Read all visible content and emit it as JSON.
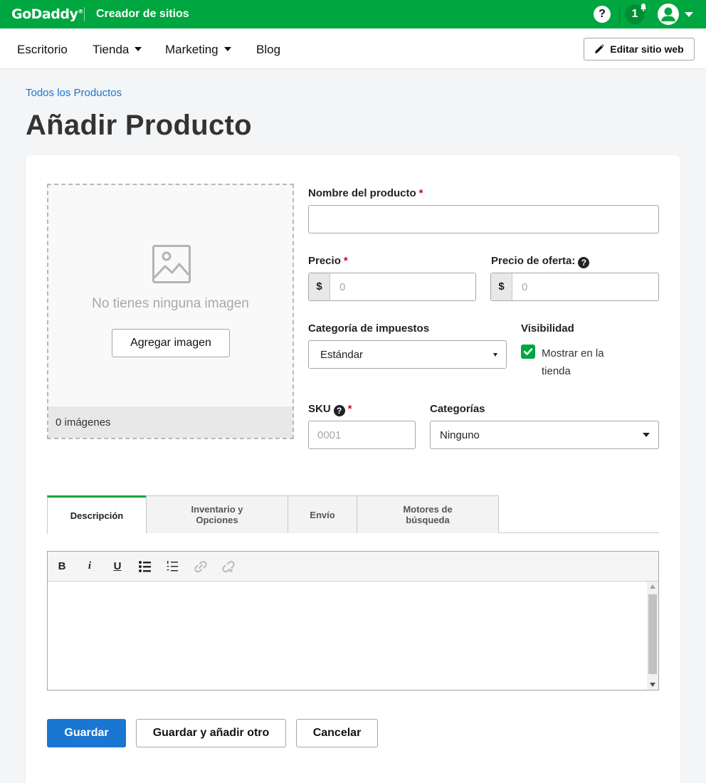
{
  "topbar": {
    "brand": "GoDaddy",
    "brand_mark": "®",
    "product": "Creador de sitios",
    "help_label": "?",
    "notifications_count": "1"
  },
  "nav": {
    "items": [
      {
        "label": "Escritorio"
      },
      {
        "label": "Tienda"
      },
      {
        "label": "Marketing"
      },
      {
        "label": "Blog"
      }
    ],
    "edit_button": "Editar sitio web"
  },
  "breadcrumb": "Todos los Productos",
  "page_title": "Añadir Producto",
  "image_panel": {
    "empty_text": "No tienes ninguna imagen",
    "add_button": "Agregar imagen",
    "count_text": "0 imágenes"
  },
  "form": {
    "name_label": "Nombre del producto",
    "required_mark": "*",
    "name_value": "",
    "price_label": "Precio",
    "price_addon": "$",
    "price_placeholder": "0",
    "sale_price_label": "Precio de oferta:",
    "sale_addon": "$",
    "sale_placeholder": "0",
    "tax_label": "Categoría de impuestos",
    "tax_value": "Estándar",
    "visibility_label": "Visibilidad",
    "visibility_checkbox": "Mostrar en la tienda",
    "visibility_checked": true,
    "sku_label": "SKU",
    "sku_placeholder": "0001",
    "categories_label": "Categorías",
    "categories_value": "Ninguno"
  },
  "tabs": [
    {
      "label": "Descripción",
      "active": true
    },
    {
      "label": "Inventario y Opciones",
      "active": false
    },
    {
      "label": "Envío",
      "active": false
    },
    {
      "label": "Motores de búsqueda",
      "active": false
    }
  ],
  "toolbar": {
    "bold": "B",
    "italic": "i",
    "underline": "U"
  },
  "actions": {
    "save": "Guardar",
    "save_add": "Guardar y añadir otro",
    "cancel": "Cancelar"
  },
  "colors": {
    "brand_green": "#00a63f",
    "primary_blue": "#1976d2",
    "link_blue": "#1976d2"
  }
}
